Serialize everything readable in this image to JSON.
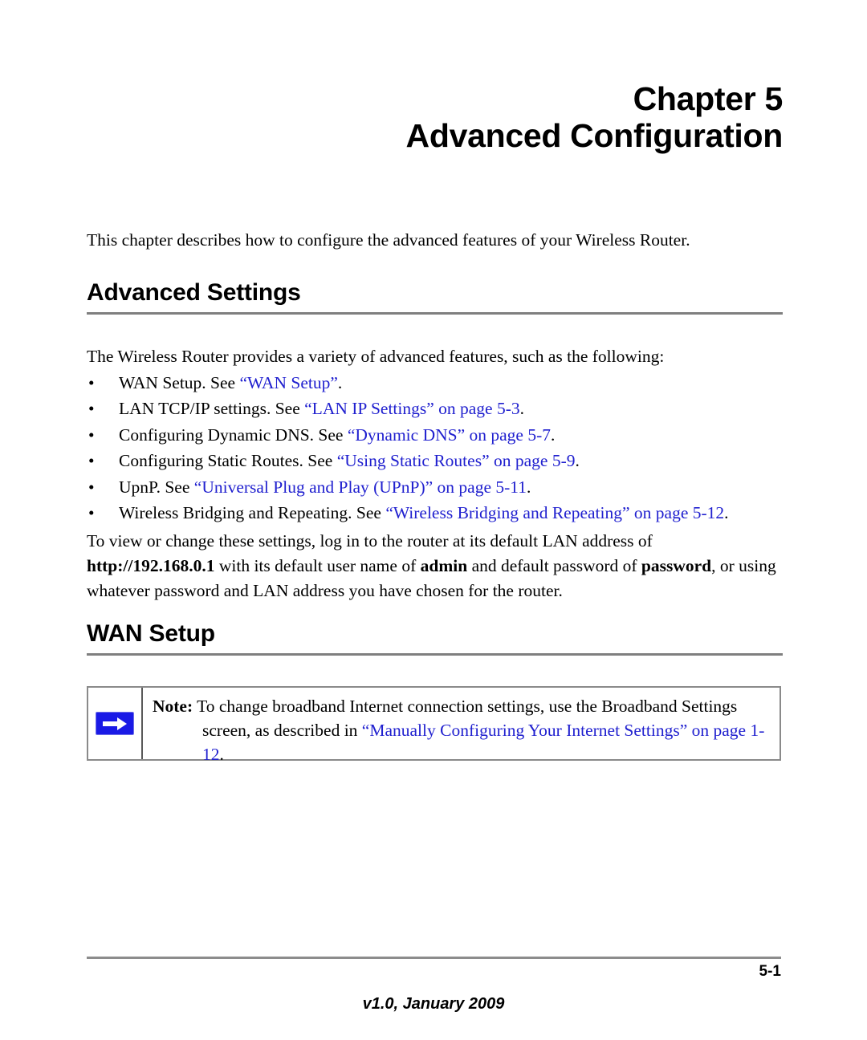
{
  "chapter": {
    "line1": "Chapter 5",
    "line2": "Advanced Configuration"
  },
  "intro_paragraph": "This chapter describes how to configure the advanced features of your Wireless Router.",
  "sections": {
    "advanced_settings": {
      "heading": "Advanced Settings",
      "lead_paragraph": "The Wireless Router provides a variety of advanced features, such as the following:",
      "bullets": [
        {
          "before": "WAN Setup. See ",
          "link": "“WAN Setup”",
          "after": "."
        },
        {
          "before": "LAN TCP/IP settings. See ",
          "link": "“LAN IP Settings” on page 5-3",
          "after": "."
        },
        {
          "before": "Configuring Dynamic DNS. See ",
          "link": "“Dynamic DNS” on page 5-7",
          "after": "."
        },
        {
          "before": "Configuring Static Routes. See ",
          "link": "“Using Static Routes” on page 5-9",
          "after": "."
        },
        {
          "before": "UpnP. See ",
          "link": "“Universal Plug and Play (UPnP)” on page 5-11",
          "after": "."
        },
        {
          "before": "Wireless Bridging and Repeating. See ",
          "link": "“Wireless Bridging and Repeating” on page 5-12",
          "after": "."
        }
      ],
      "login_paragraph": {
        "part1": "To view or change these settings, log in to the router at its default LAN address of ",
        "bold1": "http://192.168.0.1",
        "part2": " with its default user name of ",
        "bold2": "admin",
        "part3": " and default password of ",
        "bold3": "password",
        "part4": ", or using whatever password and LAN address you have chosen for the router."
      }
    },
    "wan_setup": {
      "heading": "WAN Setup",
      "note": {
        "label": "Note:",
        "text_before": " To change broadband Internet connection settings, use the Broadband Settings screen, as described in ",
        "link": "“Manually Configuring Your Internet Settings” on page 1-12",
        "text_after": ".",
        "icon": "right-arrow-icon",
        "icon_color": "#1a1ae6"
      }
    }
  },
  "footer": {
    "page_number": "5-1",
    "version": "v1.0, January 2009"
  },
  "colors": {
    "link": "#2020cf",
    "rule": "#7f7f7f",
    "note_border": "#8a8a8a"
  }
}
